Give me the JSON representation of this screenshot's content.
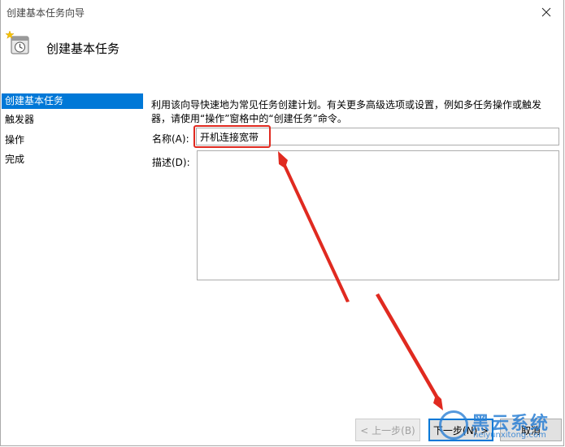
{
  "window": {
    "title": "创建基本任务向导"
  },
  "header": {
    "title": "创建基本任务"
  },
  "sidebar": {
    "items": [
      {
        "label": "创建基本任务",
        "active": true
      },
      {
        "label": "触发器",
        "active": false
      },
      {
        "label": "操作",
        "active": false
      },
      {
        "label": "完成",
        "active": false
      }
    ]
  },
  "main": {
    "description_line1": "利用该向导快速地为常见任务创建计划。有关更多高级选项或设置，例如多任务操作或触发",
    "description_line2": "器，请使用“操作”窗格中的“创建任务”命令。",
    "name_label": "名称(A):",
    "name_value": "开机连接宽带",
    "desc_label": "描述(D):",
    "desc_value": ""
  },
  "buttons": {
    "back": "< 上一步(B)",
    "next": "下一步(N) >",
    "cancel": "取消"
  },
  "annotation": {
    "color": "#e02a20"
  },
  "watermark": {
    "name": "黑云系统",
    "url": "heiyunxitong.com"
  },
  "colors": {
    "accent": "#0078d7"
  }
}
